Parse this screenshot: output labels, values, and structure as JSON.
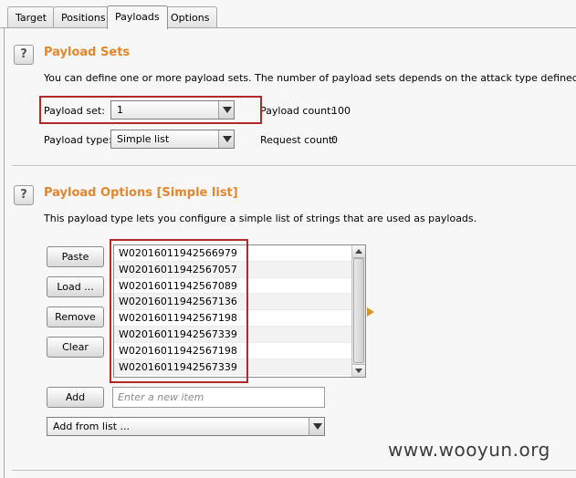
{
  "tabs": [
    {
      "label": "Target",
      "active": false
    },
    {
      "label": "Positions",
      "active": false
    },
    {
      "label": "Payloads",
      "active": true
    },
    {
      "label": "Options",
      "active": false
    }
  ],
  "payload_sets": {
    "help": "?",
    "title": "Payload Sets",
    "description": "You can define one or more payload sets. The number of payload sets depends on the attack type defined in the Positions tab.",
    "set_label": "Payload set:",
    "set_value": "1",
    "type_label": "Payload type:",
    "type_value": "Simple list",
    "payload_count_label": "Payload count:",
    "payload_count": "100",
    "request_count_label": "Request count:",
    "request_count": "0"
  },
  "payload_options": {
    "help": "?",
    "title": "Payload Options [Simple list]",
    "description": "This payload type lets you configure a simple list of strings that are used as payloads.",
    "buttons": {
      "paste": "Paste",
      "load": "Load ...",
      "remove": "Remove",
      "clear": "Clear",
      "add": "Add"
    },
    "items": [
      "W02016011942566979",
      "W02016011942567057",
      "W02016011942567089",
      "W02016011942567136",
      "W02016011942567198",
      "W02016011942567339",
      "W02016011942567198",
      "W02016011942567339"
    ],
    "new_item_placeholder": "Enter a new item",
    "add_from_list": "Add from list ..."
  },
  "watermark": "www.wooyun.org",
  "colors": {
    "accent": "#e3872e",
    "highlight_box": "#b02a2a"
  }
}
